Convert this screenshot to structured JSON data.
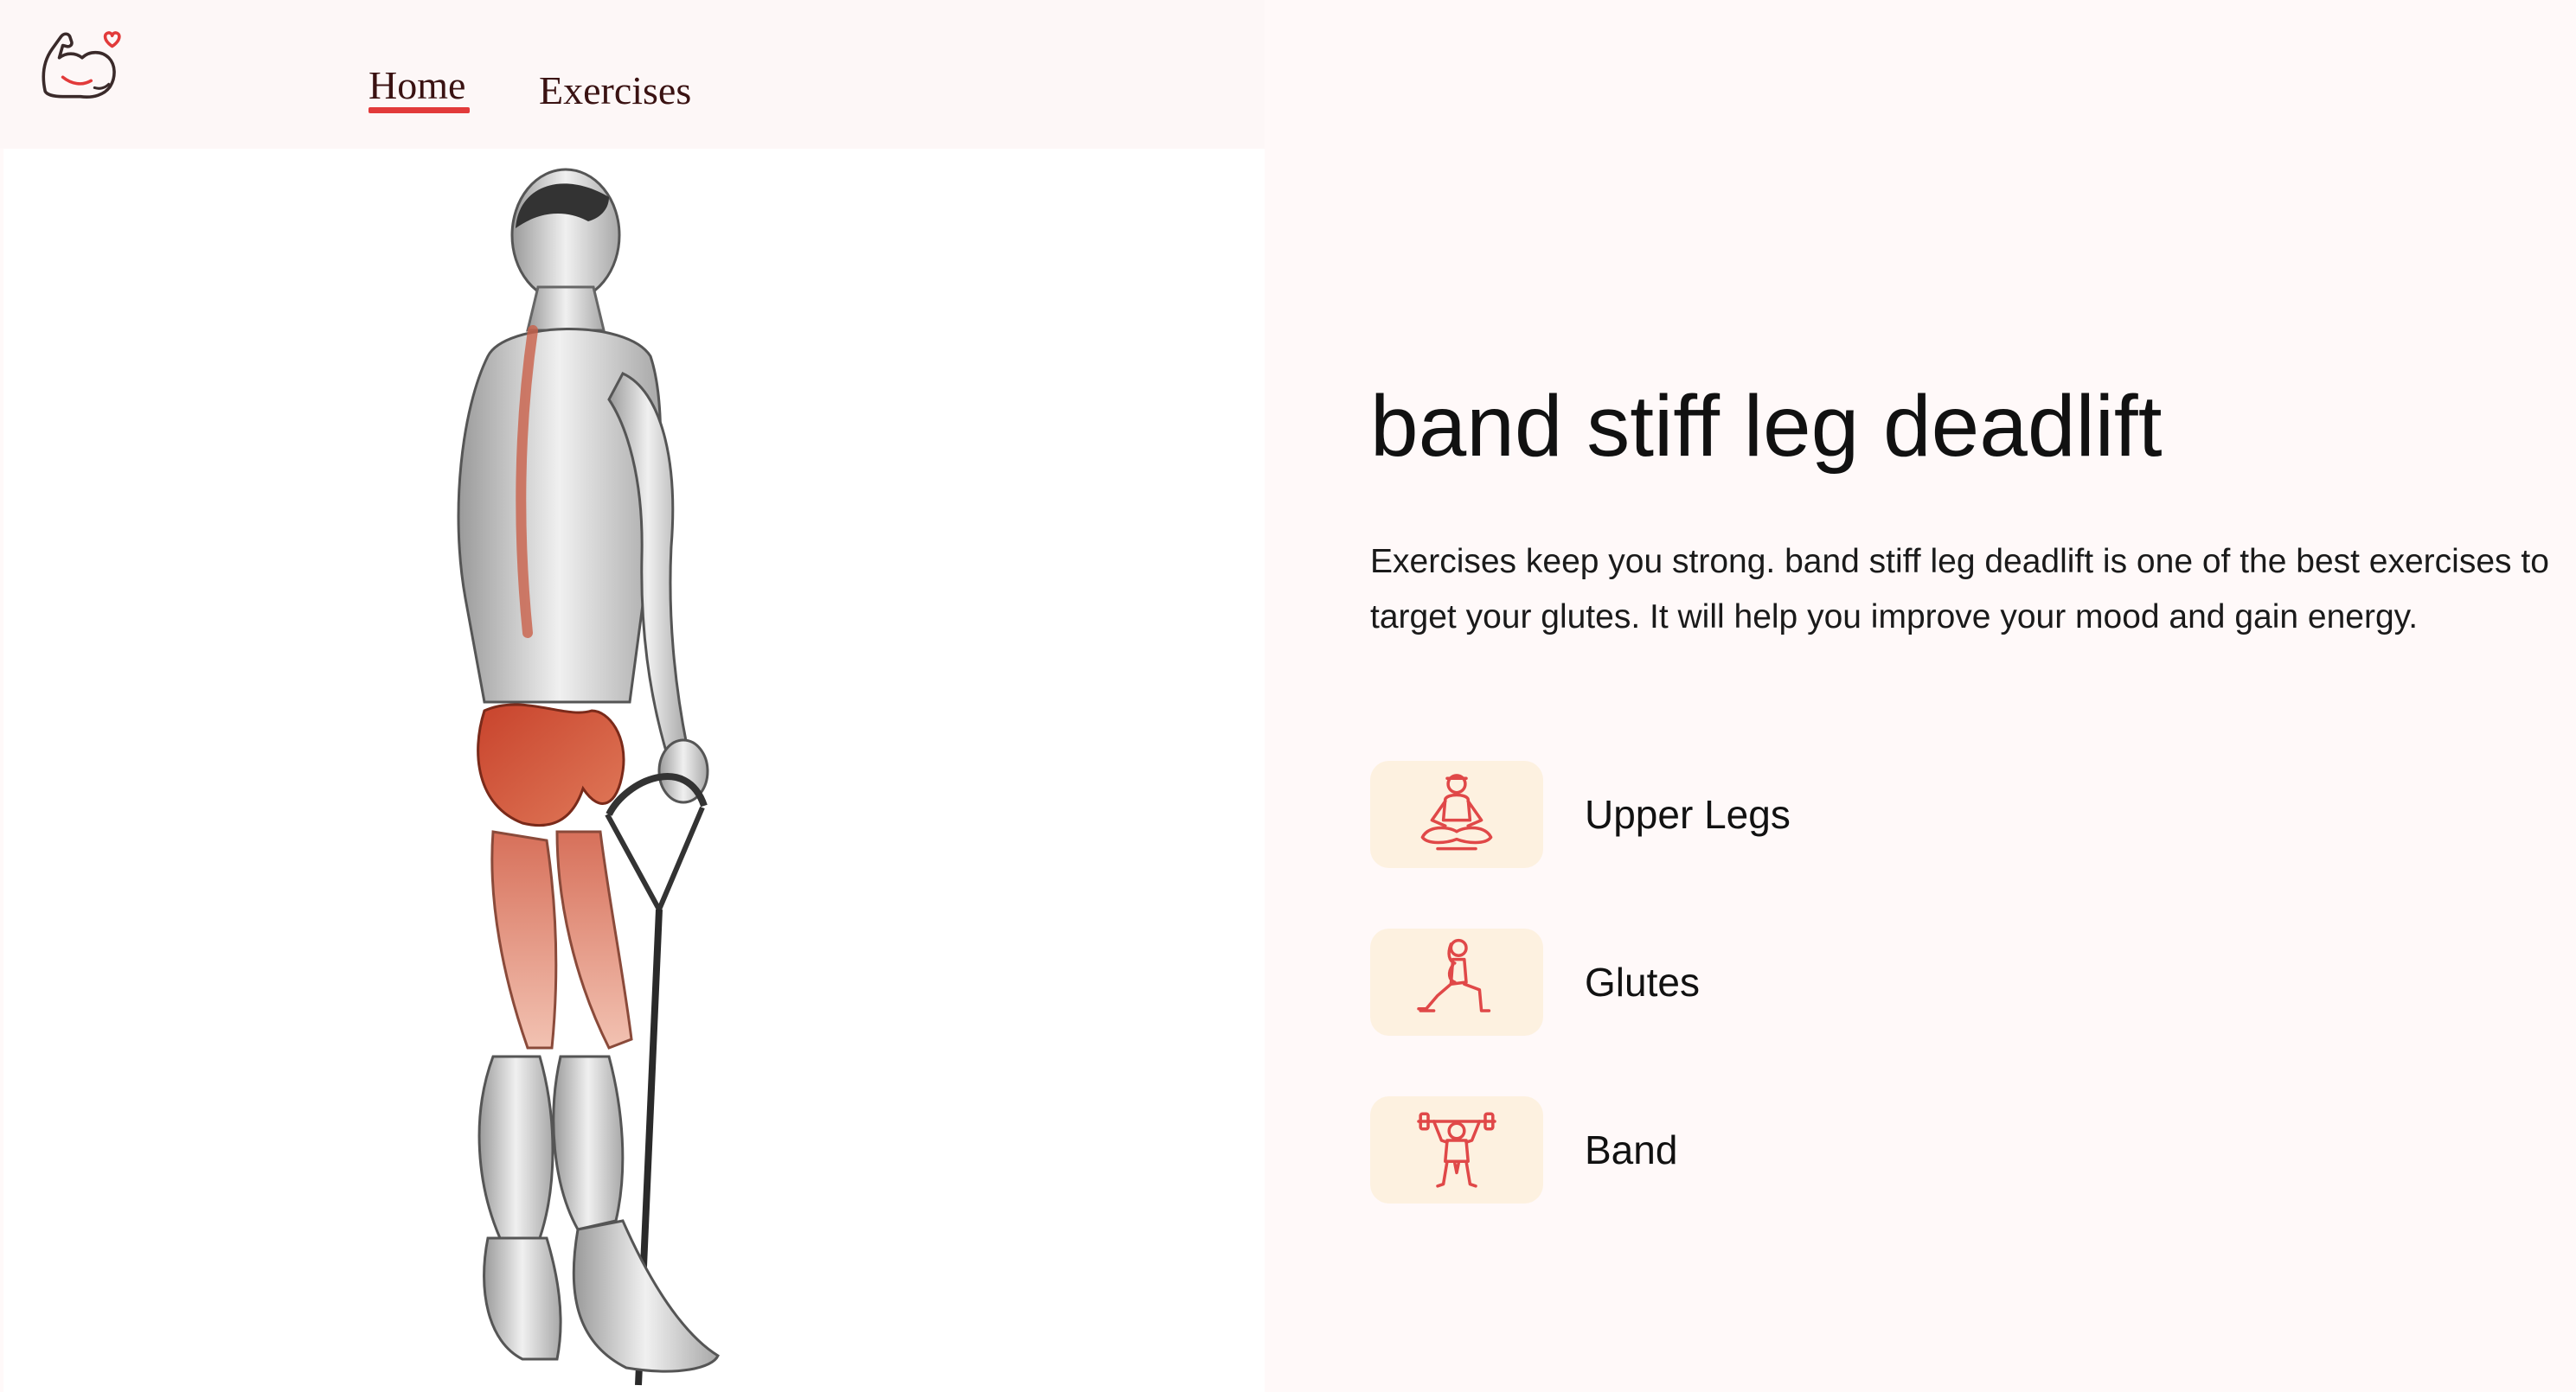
{
  "header": {
    "nav": {
      "home_label": "Home",
      "exercises_label": "Exercises"
    },
    "logo_icon": "flexed-arm-heart-icon"
  },
  "exercise": {
    "name": "band stiff leg deadlift",
    "description": "Exercises keep you strong. band stiff leg deadlift is one of the best exercises to target your glutes. It will help you improve your mood and gain energy.",
    "image_icon": "exercise-illustration",
    "tags": [
      {
        "label": "Upper Legs",
        "icon": "meditation-pose-icon"
      },
      {
        "label": "Glutes",
        "icon": "lunge-pose-icon"
      },
      {
        "label": "Band",
        "icon": "weightlifter-icon"
      }
    ]
  },
  "colors": {
    "accent": "#e23a3a",
    "tag_background": "#fdf1e0",
    "page_background": "#fff9f9",
    "icon_stroke": "#e04848"
  }
}
